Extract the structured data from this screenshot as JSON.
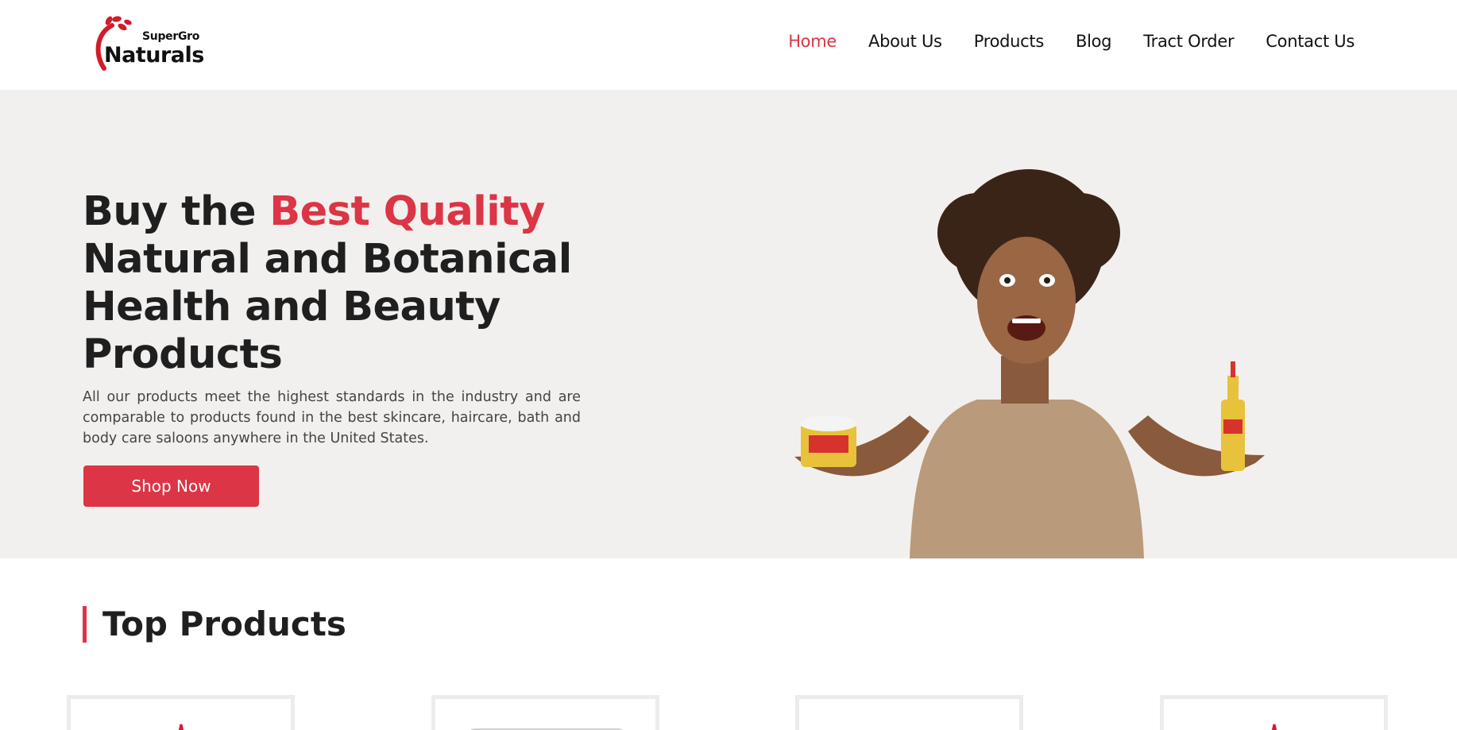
{
  "brand": {
    "sub": "SuperGro",
    "main": "Naturals",
    "accent": "#dc3545"
  },
  "nav": {
    "items": [
      {
        "label": "Home",
        "active": true
      },
      {
        "label": "About Us"
      },
      {
        "label": "Products"
      },
      {
        "label": "Blog"
      },
      {
        "label": "Tract Order"
      },
      {
        "label": "Contact Us"
      }
    ]
  },
  "hero": {
    "title_prefix": "Buy the ",
    "title_highlight": "Best Quality",
    "title_rest": "Natural and Botanical Health and Beauty Products",
    "description": "All our products meet the highest standards in the industry and are comparable to products found in the best skincare, haircare, bath and body care saloons anywhere in the United States.",
    "button": "Shop Now"
  },
  "top_products": {
    "title": "Top Products"
  }
}
